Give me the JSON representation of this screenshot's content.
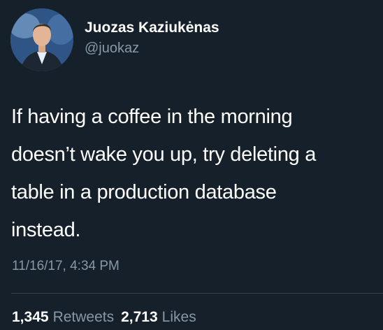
{
  "author": {
    "display_name": "Juozas Kaziukėnas",
    "handle": "@juokaz"
  },
  "tweet": {
    "lines": [
      "If having a coffee in the morning",
      "doesn’t wake you up, try deleting a",
      "table in a production database",
      "instead."
    ],
    "timestamp": "11/16/17, 4:34 PM"
  },
  "stats": {
    "retweets_count": "1,345",
    "retweets_label": "Retweets",
    "likes_count": "2,713",
    "likes_label": "Likes"
  },
  "colors": {
    "background": "#15202b",
    "primary_text": "#ffffff",
    "secondary_text": "#8899a6",
    "divider": "#38444d"
  }
}
